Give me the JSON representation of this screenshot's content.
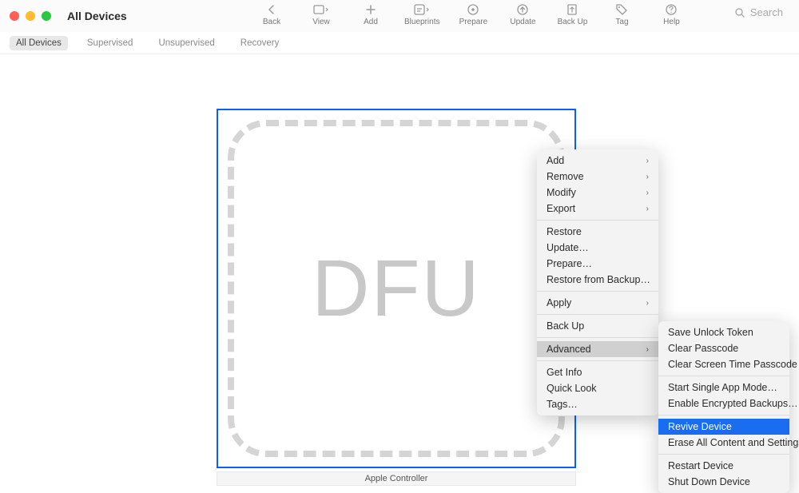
{
  "window": {
    "title": "All Devices"
  },
  "toolbar": {
    "items": [
      {
        "name": "back",
        "label": "Back"
      },
      {
        "name": "view",
        "label": "View"
      },
      {
        "name": "add",
        "label": "Add"
      },
      {
        "name": "blueprints",
        "label": "Blueprints"
      },
      {
        "name": "prepare",
        "label": "Prepare"
      },
      {
        "name": "update",
        "label": "Update"
      },
      {
        "name": "backup",
        "label": "Back Up"
      },
      {
        "name": "tag",
        "label": "Tag"
      },
      {
        "name": "help",
        "label": "Help"
      }
    ],
    "search_placeholder": "Search"
  },
  "scopebar": {
    "items": [
      {
        "label": "All Devices",
        "active": true
      },
      {
        "label": "Supervised",
        "active": false
      },
      {
        "label": "Unsupervised",
        "active": false
      },
      {
        "label": "Recovery",
        "active": false
      }
    ]
  },
  "device": {
    "mode_text": "DFU",
    "label": "Apple Controller"
  },
  "context_menu": {
    "groups": [
      [
        {
          "label": "Add",
          "submenu": true
        },
        {
          "label": "Remove",
          "submenu": true
        },
        {
          "label": "Modify",
          "submenu": true
        },
        {
          "label": "Export",
          "submenu": true
        }
      ],
      [
        {
          "label": "Restore"
        },
        {
          "label": "Update…"
        },
        {
          "label": "Prepare…"
        },
        {
          "label": "Restore from Backup…"
        }
      ],
      [
        {
          "label": "Apply",
          "submenu": true
        }
      ],
      [
        {
          "label": "Back Up"
        }
      ],
      [
        {
          "label": "Advanced",
          "submenu": true,
          "highlighted": true
        }
      ],
      [
        {
          "label": "Get Info"
        },
        {
          "label": "Quick Look"
        },
        {
          "label": "Tags…"
        }
      ]
    ]
  },
  "advanced_submenu": {
    "groups": [
      [
        {
          "label": "Save Unlock Token"
        },
        {
          "label": "Clear Passcode"
        },
        {
          "label": "Clear Screen Time Passcode"
        }
      ],
      [
        {
          "label": "Start Single App Mode…"
        },
        {
          "label": "Enable Encrypted Backups…"
        }
      ],
      [
        {
          "label": "Revive Device",
          "selected": true
        },
        {
          "label": "Erase All Content and Settings"
        }
      ],
      [
        {
          "label": "Restart Device"
        },
        {
          "label": "Shut Down Device"
        }
      ]
    ]
  }
}
